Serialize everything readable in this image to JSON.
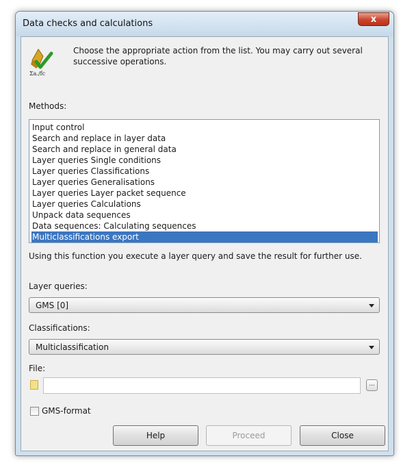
{
  "window": {
    "title": "Data checks and calculations",
    "close_label": "x"
  },
  "intro_text": "Choose the appropriate action from the list. You may carry out several successive operations.",
  "icon_caption": "Σa./fc",
  "methods": {
    "label": "Methods:",
    "items": [
      "Input control",
      "Search and replace in layer data",
      "Search and replace in general data",
      "Layer queries Single conditions",
      "Layer queries Classifications",
      "Layer queries Generalisations",
      "Layer queries Layer packet sequence",
      "Layer queries Calculations",
      "Unpack data sequences",
      "Data sequences: Calculating sequences",
      "Multiclassifications export"
    ],
    "selected_index": 10
  },
  "description": "Using this function you execute a layer query and save the result for further use.",
  "layer_queries": {
    "label": "Layer queries:",
    "value": "GMS [0]"
  },
  "classifications": {
    "label": "Classifications:",
    "value": "Multiclassification"
  },
  "file": {
    "label": "File:",
    "value": "",
    "browse_label": "..."
  },
  "gms_format": {
    "label": "GMS-format",
    "checked": false
  },
  "buttons": {
    "help": "Help",
    "proceed": "Proceed",
    "close": "Close"
  },
  "colors": {
    "selection": "#3b76c1",
    "close_button": "#c9452c"
  }
}
